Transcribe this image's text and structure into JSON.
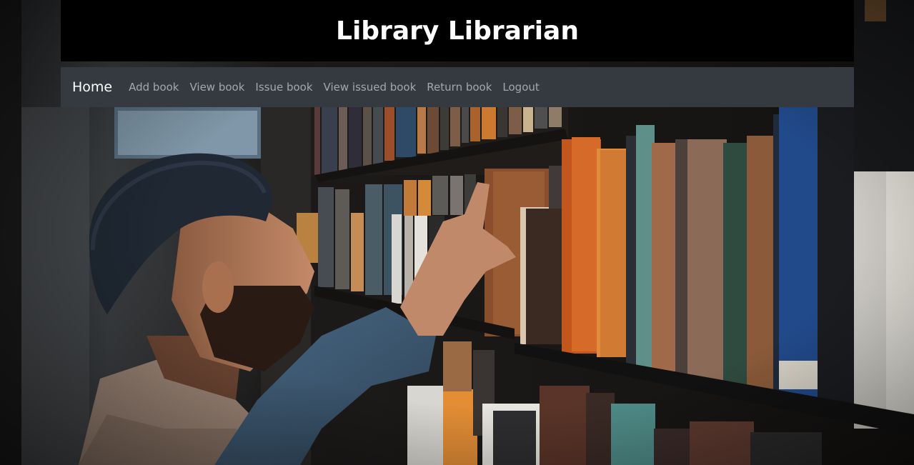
{
  "header": {
    "title": "Library Librarian"
  },
  "nav": {
    "brand": "Home",
    "links": [
      "Add book",
      "View book",
      "Issue book",
      "View issued book",
      "Return book",
      "Logout"
    ]
  },
  "colors": {
    "header_bg": "#000000",
    "navbar_bg": "#343a40",
    "brand_text": "#ffffff",
    "link_text": "rgba(255,255,255,0.55)"
  },
  "background_image": {
    "icon": "library-photo-person-reaching-for-book"
  }
}
